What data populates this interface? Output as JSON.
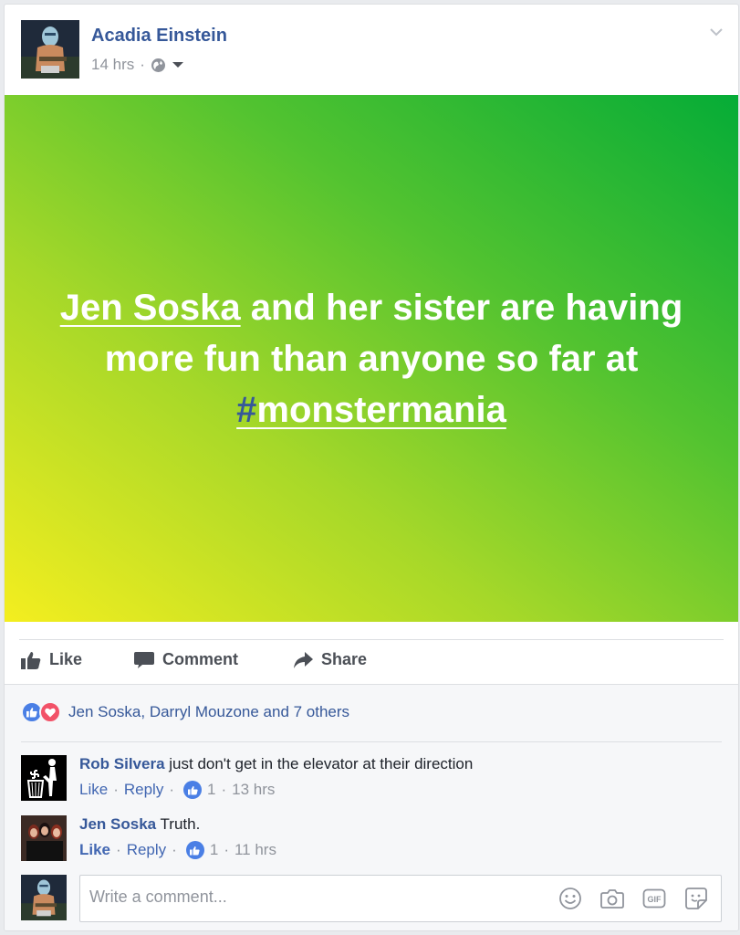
{
  "post": {
    "author": "Acadia Einstein",
    "time": "14 hrs",
    "separator": "·",
    "banner": {
      "mention": "Jen Soska",
      "text_middle": " and her sister are having more fun than anyone so far at ",
      "hashtag_symbol": "#",
      "hashtag_word": "monstermania",
      "gradient_colors": [
        "#f4ee1f",
        "#a6d829",
        "#53c330",
        "#05ac37"
      ]
    }
  },
  "actions": {
    "like": "Like",
    "comment": "Comment",
    "share": "Share"
  },
  "reactions": {
    "summary": "Jen Soska, Darryl Mouzone and 7 others",
    "icons": [
      "like-icon",
      "love-icon"
    ]
  },
  "comments": [
    {
      "name": "Rob Silvera",
      "text": " just don't get in the elevator at their direction",
      "like": "Like",
      "reply": "Reply",
      "likes": "1",
      "time": "13 hrs"
    },
    {
      "name": "Jen Soska",
      "text": " Truth.",
      "like": "Like",
      "reply": "Reply",
      "likes": "1",
      "time": "11 hrs"
    }
  ],
  "composer": {
    "placeholder": "Write a comment...",
    "icons": [
      "emoji-icon",
      "camera-icon",
      "gif-icon",
      "sticker-icon"
    ]
  },
  "colors": {
    "link": "#365899",
    "accent": "#4267b2",
    "love": "#f25268",
    "like_bubble": "#4a7fe5"
  }
}
